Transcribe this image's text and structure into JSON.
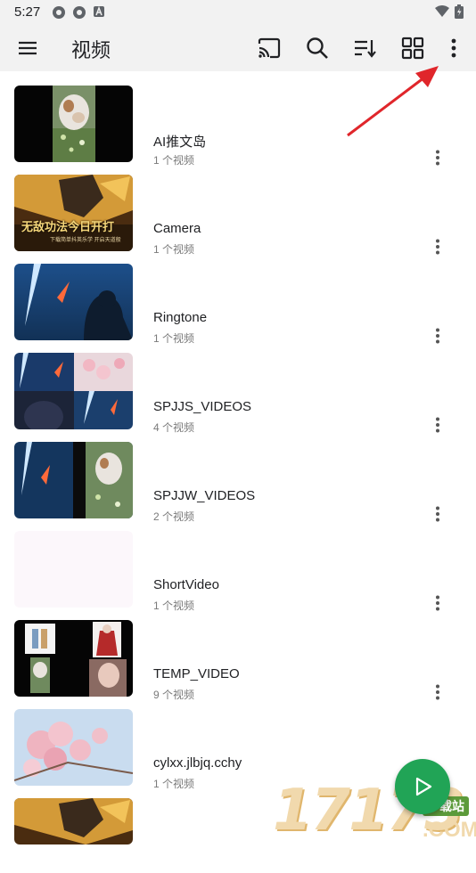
{
  "status": {
    "time": "5:27"
  },
  "appbar": {
    "title": "视频"
  },
  "folders": [
    {
      "name": "AI推文岛",
      "count": "1 个视频"
    },
    {
      "name": "Camera",
      "count": "1 个视频"
    },
    {
      "name": "Ringtone",
      "count": "1 个视频"
    },
    {
      "name": "SPJJS_VIDEOS",
      "count": "4 个视频"
    },
    {
      "name": "SPJJW_VIDEOS",
      "count": "2 个视频"
    },
    {
      "name": "ShortVideo",
      "count": "1 个视频"
    },
    {
      "name": "TEMP_VIDEO",
      "count": "9 个视频"
    },
    {
      "name": "cylxx.jlbjq.cchy",
      "count": "1 个视频"
    }
  ],
  "thumbs": {
    "t2_caption": "无敌功法今日开打",
    "t2_sub": "下载简单抖英乐学 开启天道般"
  },
  "watermark": {
    "number": "17173",
    "tag": "下载站",
    "domain": ".COM"
  },
  "colors": {
    "accent": "#21a456",
    "annotation_arrow": "#e0262b"
  },
  "icons": [
    "menu-icon",
    "cast-icon",
    "search-icon",
    "sort-icon",
    "grid-view-icon",
    "more-vert-icon",
    "play-icon"
  ]
}
